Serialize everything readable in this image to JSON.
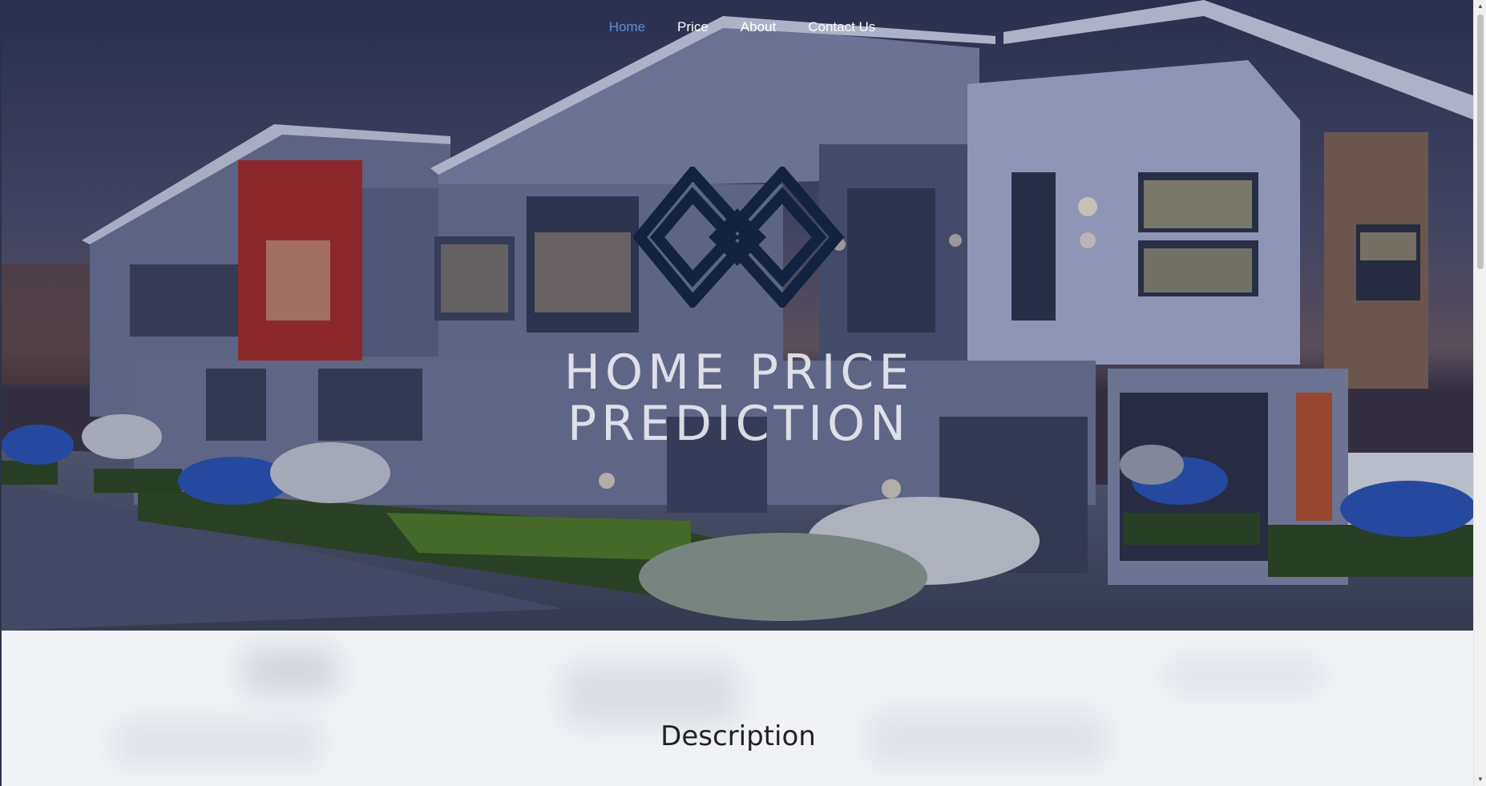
{
  "nav": {
    "items": [
      {
        "label": "Home",
        "active": true
      },
      {
        "label": "Price",
        "active": false
      },
      {
        "label": "About",
        "active": false
      },
      {
        "label": "Contact Us",
        "active": false
      }
    ],
    "active_color": "#5b8fd6"
  },
  "hero": {
    "title_line1": "HOME PRICE",
    "title_line2": "PREDICTION",
    "logo_icon": "diamond-knot-logo",
    "logo_color": "#12223f"
  },
  "section": {
    "heading": "Description"
  }
}
